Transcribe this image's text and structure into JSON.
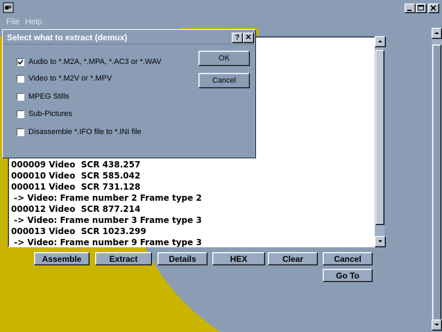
{
  "menu": {
    "file": "File",
    "help": "Help"
  },
  "log": {
    "lines": [
      "000009 Video  SCR 438.257",
      "000010 Video  SCR 585.042",
      "000011 Video  SCR 731.128",
      " -> Video: Frame number 2 Frame type 2",
      "000012 Video  SCR 877.214",
      " -> Video: Frame number 3 Frame type 3",
      "000013 Video  SCR 1023.299",
      " -> Video: Frame number 9 Frame type 3"
    ]
  },
  "buttons": {
    "assemble": "Assemble",
    "extract": "Extract",
    "details": "Details",
    "hex": "HEX",
    "clear": "Clear",
    "cancel": "Cancel",
    "goto": "Go To"
  },
  "dialog": {
    "title": "Select what to extract (demux)",
    "help_btn": "?",
    "close_btn": "✕",
    "options": [
      {
        "label": "Audio to *.M2A, *.MPA, *.AC3 or *.WAV",
        "checked": true
      },
      {
        "label": "Video to *.M2V or *.MPV",
        "checked": false
      },
      {
        "label": "MPEG Stills",
        "checked": false
      },
      {
        "label": "Sub-Pictures",
        "checked": false
      },
      {
        "label": "Disassemble *.IFO file to *.INI file",
        "checked": false
      }
    ],
    "ok": "OK",
    "cancel": "Cancel"
  },
  "colors": {
    "background": "#8a9db5",
    "accent_arc": "#c9b400"
  }
}
